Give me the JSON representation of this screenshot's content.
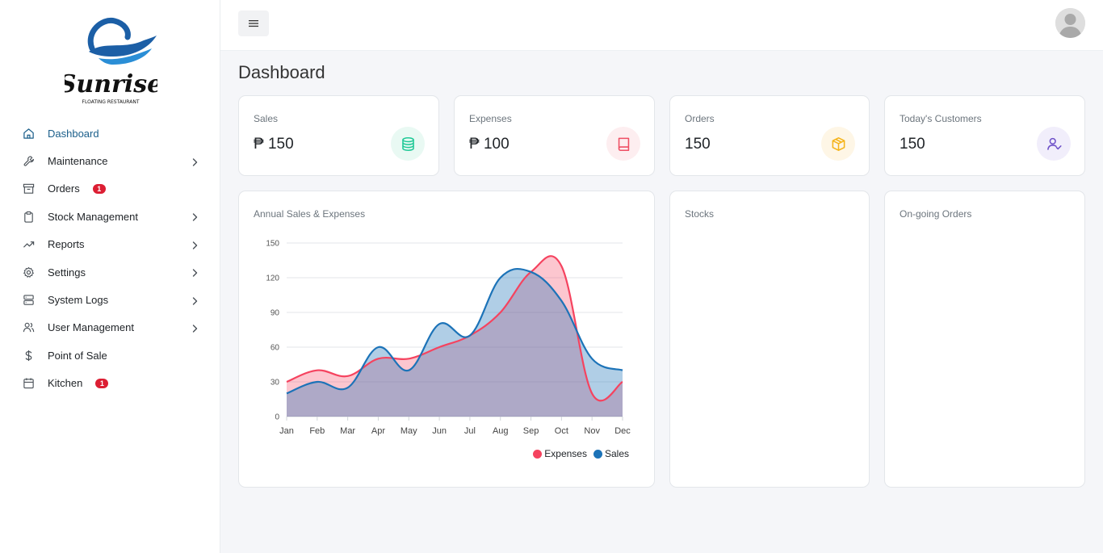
{
  "brand": {
    "name": "Sunrise",
    "tagline": "FLOATING RESTAURANT"
  },
  "sidebar": {
    "items": [
      {
        "label": "Dashboard",
        "icon": "home-icon",
        "active": true,
        "badge": null,
        "chevron": false
      },
      {
        "label": "Maintenance",
        "icon": "wrench-icon",
        "active": false,
        "badge": null,
        "chevron": true
      },
      {
        "label": "Orders",
        "icon": "archive-box-icon",
        "active": false,
        "badge": "1",
        "chevron": false
      },
      {
        "label": "Stock Management",
        "icon": "clipboard-icon",
        "active": false,
        "badge": null,
        "chevron": true
      },
      {
        "label": "Reports",
        "icon": "trending-up-icon",
        "active": false,
        "badge": null,
        "chevron": true
      },
      {
        "label": "Settings",
        "icon": "gear-icon",
        "active": false,
        "badge": null,
        "chevron": true
      },
      {
        "label": "System Logs",
        "icon": "server-icon",
        "active": false,
        "badge": null,
        "chevron": true
      },
      {
        "label": "User Management",
        "icon": "users-icon",
        "active": false,
        "badge": null,
        "chevron": true
      },
      {
        "label": "Point of Sale",
        "icon": "dollar-icon",
        "active": false,
        "badge": null,
        "chevron": false
      },
      {
        "label": "Kitchen",
        "icon": "calendar-icon",
        "active": false,
        "badge": "1",
        "chevron": false
      }
    ]
  },
  "header": {
    "menu_icon": "hamburger-icon",
    "avatar_icon": "user-avatar-icon"
  },
  "page": {
    "title": "Dashboard"
  },
  "stats": [
    {
      "label": "Sales",
      "value": "₱ 150",
      "icon": "database-icon",
      "color": "#20c997",
      "bg": "#e9f9f3"
    },
    {
      "label": "Expenses",
      "value": "₱ 100",
      "icon": "book-icon",
      "color": "#ef4f64",
      "bg": "#fdeef0"
    },
    {
      "label": "Orders",
      "value": "150",
      "icon": "box-icon",
      "color": "#f5b41b",
      "bg": "#fef6e6"
    },
    {
      "label": "Today's Customers",
      "value": "150",
      "icon": "user-check-icon",
      "color": "#6f52c9",
      "bg": "#f1eefb"
    }
  ],
  "panels": {
    "annual": "Annual Sales & Expenses",
    "stocks": "Stocks",
    "ongoing": "On-going Orders"
  },
  "chart_data": {
    "type": "area",
    "title": "Annual Sales & Expenses",
    "categories": [
      "Jan",
      "Feb",
      "Mar",
      "Apr",
      "May",
      "Jun",
      "Jul",
      "Aug",
      "Sep",
      "Oct",
      "Nov",
      "Dec"
    ],
    "series": [
      {
        "name": "Expenses",
        "color": "#f5435f",
        "values": [
          30,
          40,
          35,
          50,
          50,
          60,
          70,
          90,
          125,
          130,
          20,
          30
        ]
      },
      {
        "name": "Sales",
        "color": "#1c73b8",
        "values": [
          20,
          30,
          25,
          60,
          40,
          80,
          70,
          120,
          125,
          100,
          50,
          40
        ]
      }
    ],
    "yticks": [
      0,
      30,
      60,
      90,
      120,
      150
    ],
    "ylim": [
      0,
      150
    ],
    "grid": true,
    "legend": "bottom-right"
  }
}
